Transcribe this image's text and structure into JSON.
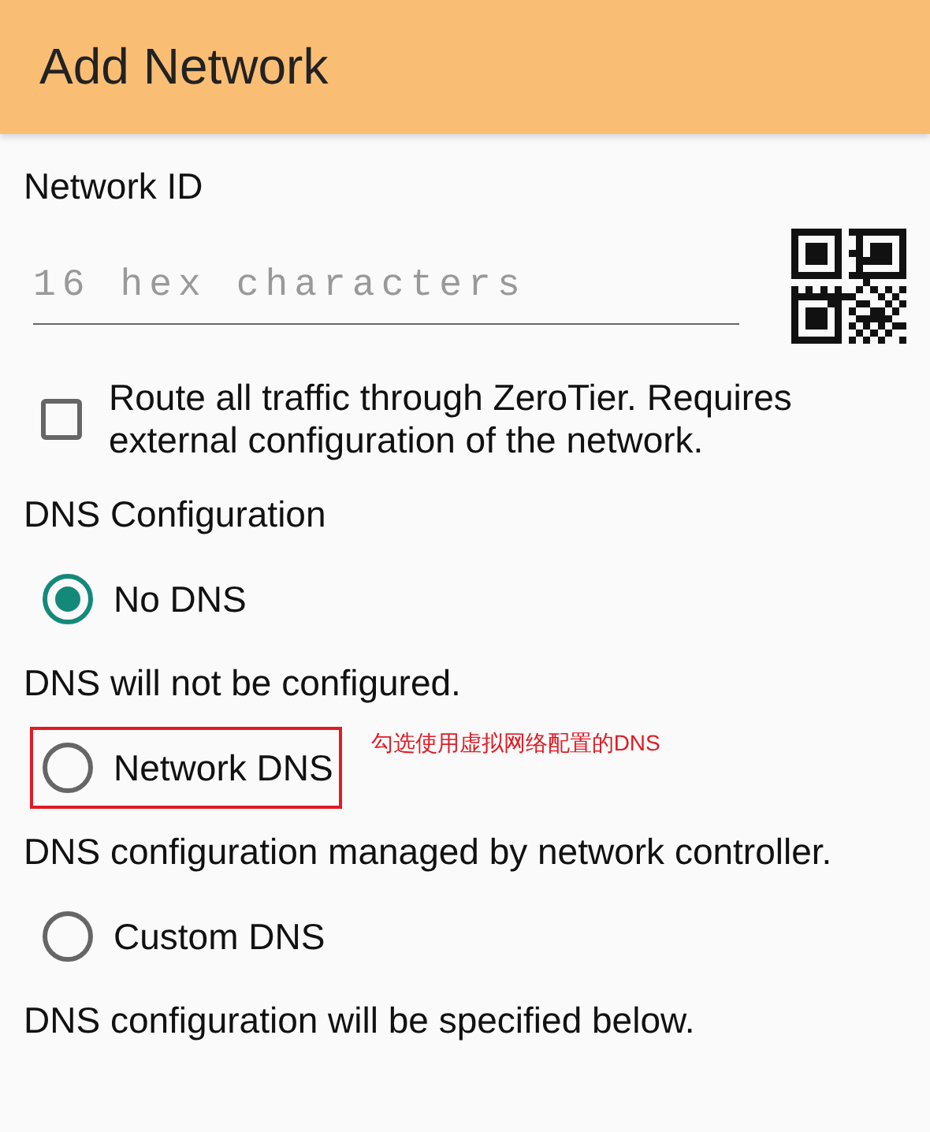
{
  "app_bar": {
    "title": "Add Network"
  },
  "network_id": {
    "label": "Network ID",
    "placeholder": "16 hex characters"
  },
  "route_all": {
    "label": "Route all traffic through ZeroTier. Requires external configuration of the network.",
    "checked": false
  },
  "dns": {
    "heading": "DNS Configuration",
    "options": [
      {
        "label": "No DNS",
        "description": "DNS will not be configured.",
        "selected": true,
        "highlighted": false
      },
      {
        "label": "Network DNS",
        "description": "DNS configuration managed by network controller.",
        "selected": false,
        "highlighted": true,
        "annotation": "勾选使用虚拟网络配置的DNS"
      },
      {
        "label": "Custom DNS",
        "description": "DNS configuration will be specified below.",
        "selected": false,
        "highlighted": false
      }
    ]
  }
}
